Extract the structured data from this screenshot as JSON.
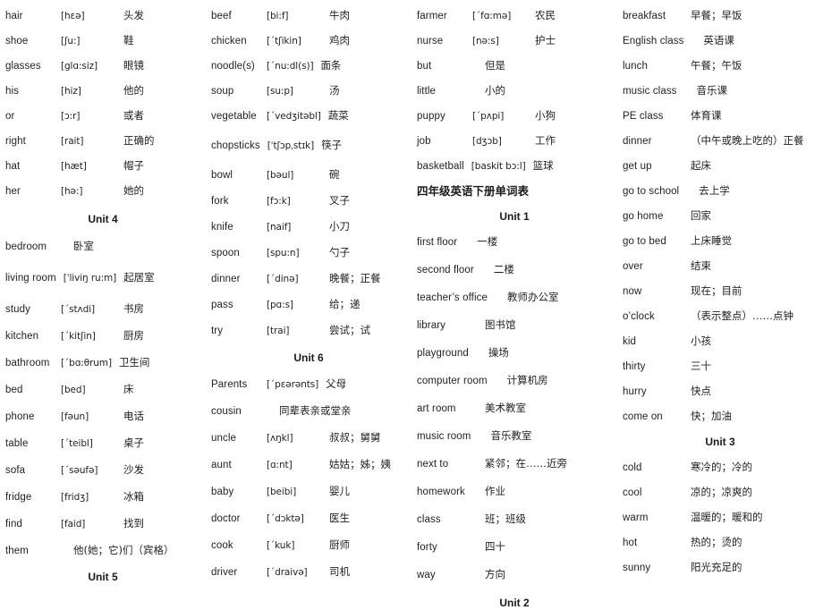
{
  "document": {
    "title": "四年级英语下册单词表",
    "type": "vocabulary-list",
    "columns": 4
  },
  "columns": [
    {
      "id": "column-1",
      "rows": [
        {
          "kind": "entry",
          "word": "hair",
          "phonetic": "[hɛə]",
          "meaning": "头发",
          "gap": 12
        },
        {
          "kind": "entry",
          "word": "shoe",
          "phonetic": "[ʃu:]",
          "meaning": "鞋",
          "gap": 12
        },
        {
          "kind": "entry",
          "word": "glasses",
          "phonetic": "[glɑ:siz]",
          "meaning": "眼镜",
          "gap": 12
        },
        {
          "kind": "entry",
          "word": "his",
          "phonetic": "[hiz]",
          "meaning": "他的",
          "gap": 12
        },
        {
          "kind": "entry",
          "word": "or",
          "phonetic": "[ɔ:r]",
          "meaning": "或者",
          "gap": 12
        },
        {
          "kind": "entry",
          "word": "right",
          "phonetic": "[rait]",
          "meaning": "正确的",
          "gap": 12
        },
        {
          "kind": "entry",
          "word": "hat",
          "phonetic": "[hæt]",
          "meaning": "帽子",
          "gap": 12
        },
        {
          "kind": "entry",
          "word": "her",
          "phonetic": "[hə:]",
          "meaning": "她的",
          "gap": 16
        },
        {
          "kind": "unit",
          "label": "Unit 4",
          "gap": 15
        },
        {
          "kind": "entry",
          "word": "bedroom",
          "phonetic": "",
          "meaning": "卧室",
          "gap": 19
        },
        {
          "kind": "entry",
          "word": "living room",
          "phonetic": "[ˈliviŋ ru:m]",
          "meaning": "起居室",
          "gap": 19
        },
        {
          "kind": "entry",
          "word": "study",
          "phonetic": "[ˊstʌdi]",
          "meaning": "书房",
          "gap": 14
        },
        {
          "kind": "entry",
          "word": "kitchen",
          "phonetic": "[ˊkitʃin]",
          "meaning": "厨房",
          "gap": 14
        },
        {
          "kind": "entry",
          "word": "bathroom",
          "phonetic": "[ˊbɑ:θrum]",
          "meaning": "卫生间",
          "gap": 14
        },
        {
          "kind": "entry",
          "word": "bed",
          "phonetic": "[bed]",
          "meaning": "床",
          "gap": 14
        },
        {
          "kind": "entry",
          "word": "phone",
          "phonetic": "[fəun]",
          "meaning": "电话",
          "gap": 14
        },
        {
          "kind": "entry",
          "word": "table",
          "phonetic": "[ˊteibl]",
          "meaning": "桌子",
          "gap": 14
        },
        {
          "kind": "entry",
          "word": "sofa",
          "phonetic": "[ˊsəufə]",
          "meaning": "沙发",
          "gap": 14
        },
        {
          "kind": "entry",
          "word": "fridge",
          "phonetic": "[fridʒ]",
          "meaning": "冰箱",
          "gap": 14
        },
        {
          "kind": "entry",
          "word": "find",
          "phonetic": "[faid]",
          "meaning": "找到",
          "gap": 14
        },
        {
          "kind": "entry",
          "word": "them",
          "phonetic": "",
          "meaning": "他(她；它)们（宾格）",
          "gap": 14
        },
        {
          "kind": "unit",
          "label": "Unit 5",
          "gap": 0
        }
      ]
    },
    {
      "id": "column-2",
      "rows": [
        {
          "kind": "entry",
          "word": "beef",
          "phonetic": "[bi:f]",
          "meaning": "牛肉",
          "gap": 12
        },
        {
          "kind": "entry",
          "word": "chicken",
          "phonetic": "[ˊtʃikin]",
          "meaning": "鸡肉",
          "gap": 12
        },
        {
          "kind": "entry",
          "word": "noodle(s)",
          "phonetic": "[ˊnu:dl(s)]",
          "meaning": "面条",
          "gap": 12
        },
        {
          "kind": "entry",
          "word": "soup",
          "phonetic": "[su:p]",
          "meaning": "汤",
          "gap": 12
        },
        {
          "kind": "entry",
          "word": "vegetable",
          "phonetic": "[ˊvedʒitəbl]",
          "meaning": "蔬菜",
          "gap": 17
        },
        {
          "kind": "entry",
          "word": "chopsticks",
          "phonetic": "[ˈtʃɔpˌstɪk]",
          "meaning": "筷子",
          "gap": 17
        },
        {
          "kind": "entry",
          "word": "bowl",
          "phonetic": "[bəul]",
          "meaning": "碗",
          "gap": 13
        },
        {
          "kind": "entry",
          "word": "fork",
          "phonetic": "[fɔ:k]",
          "meaning": "叉子",
          "gap": 13
        },
        {
          "kind": "entry",
          "word": "knife",
          "phonetic": "[naif]",
          "meaning": "小刀",
          "gap": 13
        },
        {
          "kind": "entry",
          "word": "spoon",
          "phonetic": "[spu:n]",
          "meaning": "勺子",
          "gap": 13
        },
        {
          "kind": "entry",
          "word": "dinner",
          "phonetic": "[ˊdinə]",
          "meaning": "晚餐；正餐",
          "gap": 13
        },
        {
          "kind": "entry",
          "word": "pass",
          "phonetic": "[pɑ:s]",
          "meaning": "给；递",
          "gap": 13
        },
        {
          "kind": "entry",
          "word": "try",
          "phonetic": "[trai]",
          "meaning": "尝试；试",
          "gap": 15
        },
        {
          "kind": "unit",
          "label": "Unit 6",
          "gap": 14
        },
        {
          "kind": "entry",
          "word": "Parents",
          "phonetic": "[ˊpɛərənts]",
          "meaning": "父母",
          "gap": 14
        },
        {
          "kind": "entry",
          "word": "cousin",
          "phonetic": "",
          "meaning": "同辈表亲或堂亲",
          "gap": 14
        },
        {
          "kind": "entry",
          "word": "uncle",
          "phonetic": "[ʌŋkl]",
          "meaning": "叔叔；舅舅",
          "gap": 14
        },
        {
          "kind": "entry",
          "word": "aunt",
          "phonetic": "[ɑ:nt]",
          "meaning": "姑姑；姊；姨",
          "gap": 14
        },
        {
          "kind": "entry",
          "word": "baby",
          "phonetic": "[beibi]",
          "meaning": "婴儿",
          "gap": 14
        },
        {
          "kind": "entry",
          "word": "doctor",
          "phonetic": "[ˊdɔktə]",
          "meaning": "医生",
          "gap": 14
        },
        {
          "kind": "entry",
          "word": "cook",
          "phonetic": "[ˊkuk]",
          "meaning": "厨师",
          "gap": 14
        },
        {
          "kind": "entry",
          "word": "driver",
          "phonetic": "[ˊdraivə]",
          "meaning": "司机",
          "gap": 0
        }
      ]
    },
    {
      "id": "column-3",
      "rows": [
        {
          "kind": "entry",
          "word": "farmer",
          "phonetic": "[ˊfɑ:mə]",
          "meaning": "农民",
          "gap": 12
        },
        {
          "kind": "entry",
          "word": "nurse",
          "phonetic": "[nə:s]",
          "meaning": "护士",
          "gap": 12
        },
        {
          "kind": "entry",
          "word": "but",
          "phonetic": "",
          "meaning": "但是",
          "gap": 12
        },
        {
          "kind": "entry",
          "word": "little",
          "phonetic": "",
          "meaning": "小的",
          "gap": 12
        },
        {
          "kind": "entry",
          "word": "puppy",
          "phonetic": "[ˊpʌpi]",
          "meaning": "小狗",
          "gap": 12
        },
        {
          "kind": "entry",
          "word": "job",
          "phonetic": "[dʒɔb]",
          "meaning": "工作",
          "gap": 12
        },
        {
          "kind": "entry",
          "word": "basketball",
          "phonetic": "[baskit bɔ:l]",
          "meaning": "篮球",
          "gap": 12
        },
        {
          "kind": "booktitle",
          "label": "四年级英语下册单词表",
          "gap": 14
        },
        {
          "kind": "unit",
          "label": "Unit 1",
          "gap": 13
        },
        {
          "kind": "entry",
          "word": "first floor",
          "phonetic": "",
          "meaning": "一楼",
          "gap": 15
        },
        {
          "kind": "entry",
          "word": "second floor",
          "phonetic": "",
          "meaning": "二楼",
          "gap": 15
        },
        {
          "kind": "entry",
          "word": "teacher’s office",
          "phonetic": "",
          "meaning": "教师办公室",
          "gap": 15
        },
        {
          "kind": "entry",
          "word": "library",
          "phonetic": "",
          "meaning": "图书馆",
          "gap": 15
        },
        {
          "kind": "entry",
          "word": "playground",
          "phonetic": "",
          "meaning": "操场",
          "gap": 15
        },
        {
          "kind": "entry",
          "word": "computer room",
          "phonetic": "",
          "meaning": "计算机房",
          "gap": 15
        },
        {
          "kind": "entry",
          "word": "art room",
          "phonetic": "",
          "meaning": "美术教室",
          "gap": 15
        },
        {
          "kind": "entry",
          "word": "music room",
          "phonetic": "",
          "meaning": "音乐教室",
          "gap": 15
        },
        {
          "kind": "entry",
          "word": "next to",
          "phonetic": "",
          "meaning": "紧邻；在……近旁",
          "gap": 15
        },
        {
          "kind": "entry",
          "word": "homework",
          "phonetic": "",
          "meaning": "作业",
          "gap": 15
        },
        {
          "kind": "entry",
          "word": "class",
          "phonetic": "",
          "meaning": "班；班级",
          "gap": 15
        },
        {
          "kind": "entry",
          "word": "forty",
          "phonetic": "",
          "meaning": "四十",
          "gap": 15
        },
        {
          "kind": "entry",
          "word": "way",
          "phonetic": "",
          "meaning": "方向",
          "gap": 16
        },
        {
          "kind": "unit",
          "label": "Unit 2",
          "gap": 0
        }
      ]
    },
    {
      "id": "column-4",
      "rows": [
        {
          "kind": "entry",
          "word": "breakfast",
          "phonetic": "",
          "meaning": "早餐；早饭",
          "gap": 12
        },
        {
          "kind": "entry",
          "word": "English class",
          "phonetic": "",
          "meaning": "英语课",
          "gap": 12
        },
        {
          "kind": "entry",
          "word": "lunch",
          "phonetic": "",
          "meaning": "午餐；午饭",
          "gap": 12
        },
        {
          "kind": "entry",
          "word": "music class",
          "phonetic": "",
          "meaning": "音乐课",
          "gap": 12
        },
        {
          "kind": "entry",
          "word": "PE class",
          "phonetic": "",
          "meaning": "体育课",
          "gap": 12
        },
        {
          "kind": "entry",
          "word": "dinner",
          "phonetic": "",
          "meaning": "（中午或晚上吃的）正餐",
          "gap": 12
        },
        {
          "kind": "entry",
          "word": "get up",
          "phonetic": "",
          "meaning": "起床",
          "gap": 12
        },
        {
          "kind": "entry",
          "word": "go to school",
          "phonetic": "",
          "meaning": "去上学",
          "gap": 12
        },
        {
          "kind": "entry",
          "word": "go home",
          "phonetic": "",
          "meaning": "回家",
          "gap": 12
        },
        {
          "kind": "entry",
          "word": "go to bed",
          "phonetic": "",
          "meaning": "上床睡觉",
          "gap": 12
        },
        {
          "kind": "entry",
          "word": "over",
          "phonetic": "",
          "meaning": "结束",
          "gap": 12
        },
        {
          "kind": "entry",
          "word": "now",
          "phonetic": "",
          "meaning": "现在；目前",
          "gap": 12
        },
        {
          "kind": "entry",
          "word": "o’clock",
          "phonetic": "",
          "meaning": "（表示整点）……点钟",
          "gap": 12
        },
        {
          "kind": "entry",
          "word": "kid",
          "phonetic": "",
          "meaning": "小孩",
          "gap": 12
        },
        {
          "kind": "entry",
          "word": "thirty",
          "phonetic": "",
          "meaning": "三十",
          "gap": 12
        },
        {
          "kind": "entry",
          "word": "hurry",
          "phonetic": "",
          "meaning": "快点",
          "gap": 12
        },
        {
          "kind": "entry",
          "word": "come on",
          "phonetic": "",
          "meaning": "快；加油",
          "gap": 13
        },
        {
          "kind": "unit",
          "label": "Unit 3",
          "gap": 13
        },
        {
          "kind": "entry",
          "word": "cold",
          "phonetic": "",
          "meaning": "寒冷的；冷的",
          "gap": 12
        },
        {
          "kind": "entry",
          "word": "cool",
          "phonetic": "",
          "meaning": "凉的；凉爽的",
          "gap": 12
        },
        {
          "kind": "entry",
          "word": "warm",
          "phonetic": "",
          "meaning": "温暖的；暖和的",
          "gap": 12
        },
        {
          "kind": "entry",
          "word": "hot",
          "phonetic": "",
          "meaning": "热的；烫的",
          "gap": 12
        },
        {
          "kind": "entry",
          "word": "sunny",
          "phonetic": "",
          "meaning": "阳光充足的",
          "gap": 0
        }
      ]
    }
  ],
  "layout": {
    "word_col_width": 62,
    "phon_col_width": 70
  }
}
